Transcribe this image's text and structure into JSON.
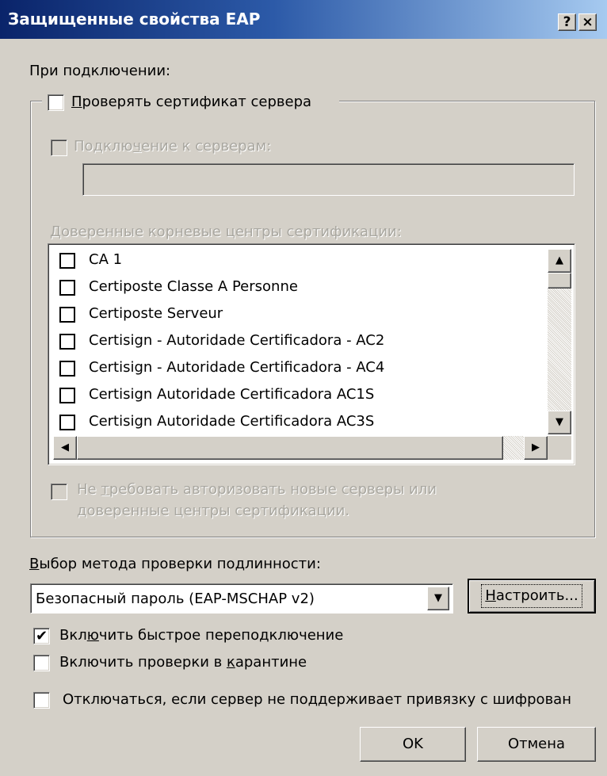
{
  "window": {
    "title": "Защищенные свойства EAP",
    "help_label": "?",
    "close_label": "×"
  },
  "connect_label": "При подключении:",
  "verify_cert": {
    "label_u": "П",
    "label_rest": "роверять сертификат сервера",
    "checked": false
  },
  "connect_servers": {
    "label_a": "Подклю",
    "label_u": "ч",
    "label_b": "ение к серверам:",
    "value": ""
  },
  "trusted_ca_label": "Доверенные корневые центры сертификации:",
  "ca_list": [
    "CA 1",
    "Certiposte Classe A Personne",
    "Certiposte Serveur",
    "Certisign - Autoridade Certificadora - AC2",
    "Certisign - Autoridade Certificadora - AC4",
    "Certisign Autoridade Certificadora AC1S",
    "Certisign Autoridade Certificadora AC3S"
  ],
  "no_prompt": {
    "line1_a": "Не ",
    "line1_u": "т",
    "line1_b": "ребовать авторизовать новые серверы или",
    "line2": "доверенные центры сертификации."
  },
  "auth_method": {
    "label_u": "В",
    "label_rest": "ыбор метода проверки подлинности:",
    "selected": "Безопасный пароль (EAP-MSCHAP v2)",
    "configure_u": "Н",
    "configure_rest": "астроить..."
  },
  "fast_reconnect": {
    "label_a": "Вкл",
    "label_u": "ю",
    "label_b": "чить быстрое переподключение",
    "checked": true
  },
  "quarantine": {
    "label_a": "Включить проверки в ",
    "label_u": "к",
    "label_b": "арантине",
    "checked": false
  },
  "disconnect": {
    "label": "Отключаться, если сервер не поддерживает привязку с шифрован",
    "checked": false
  },
  "buttons": {
    "ok": "OK",
    "cancel": "Отмена"
  }
}
